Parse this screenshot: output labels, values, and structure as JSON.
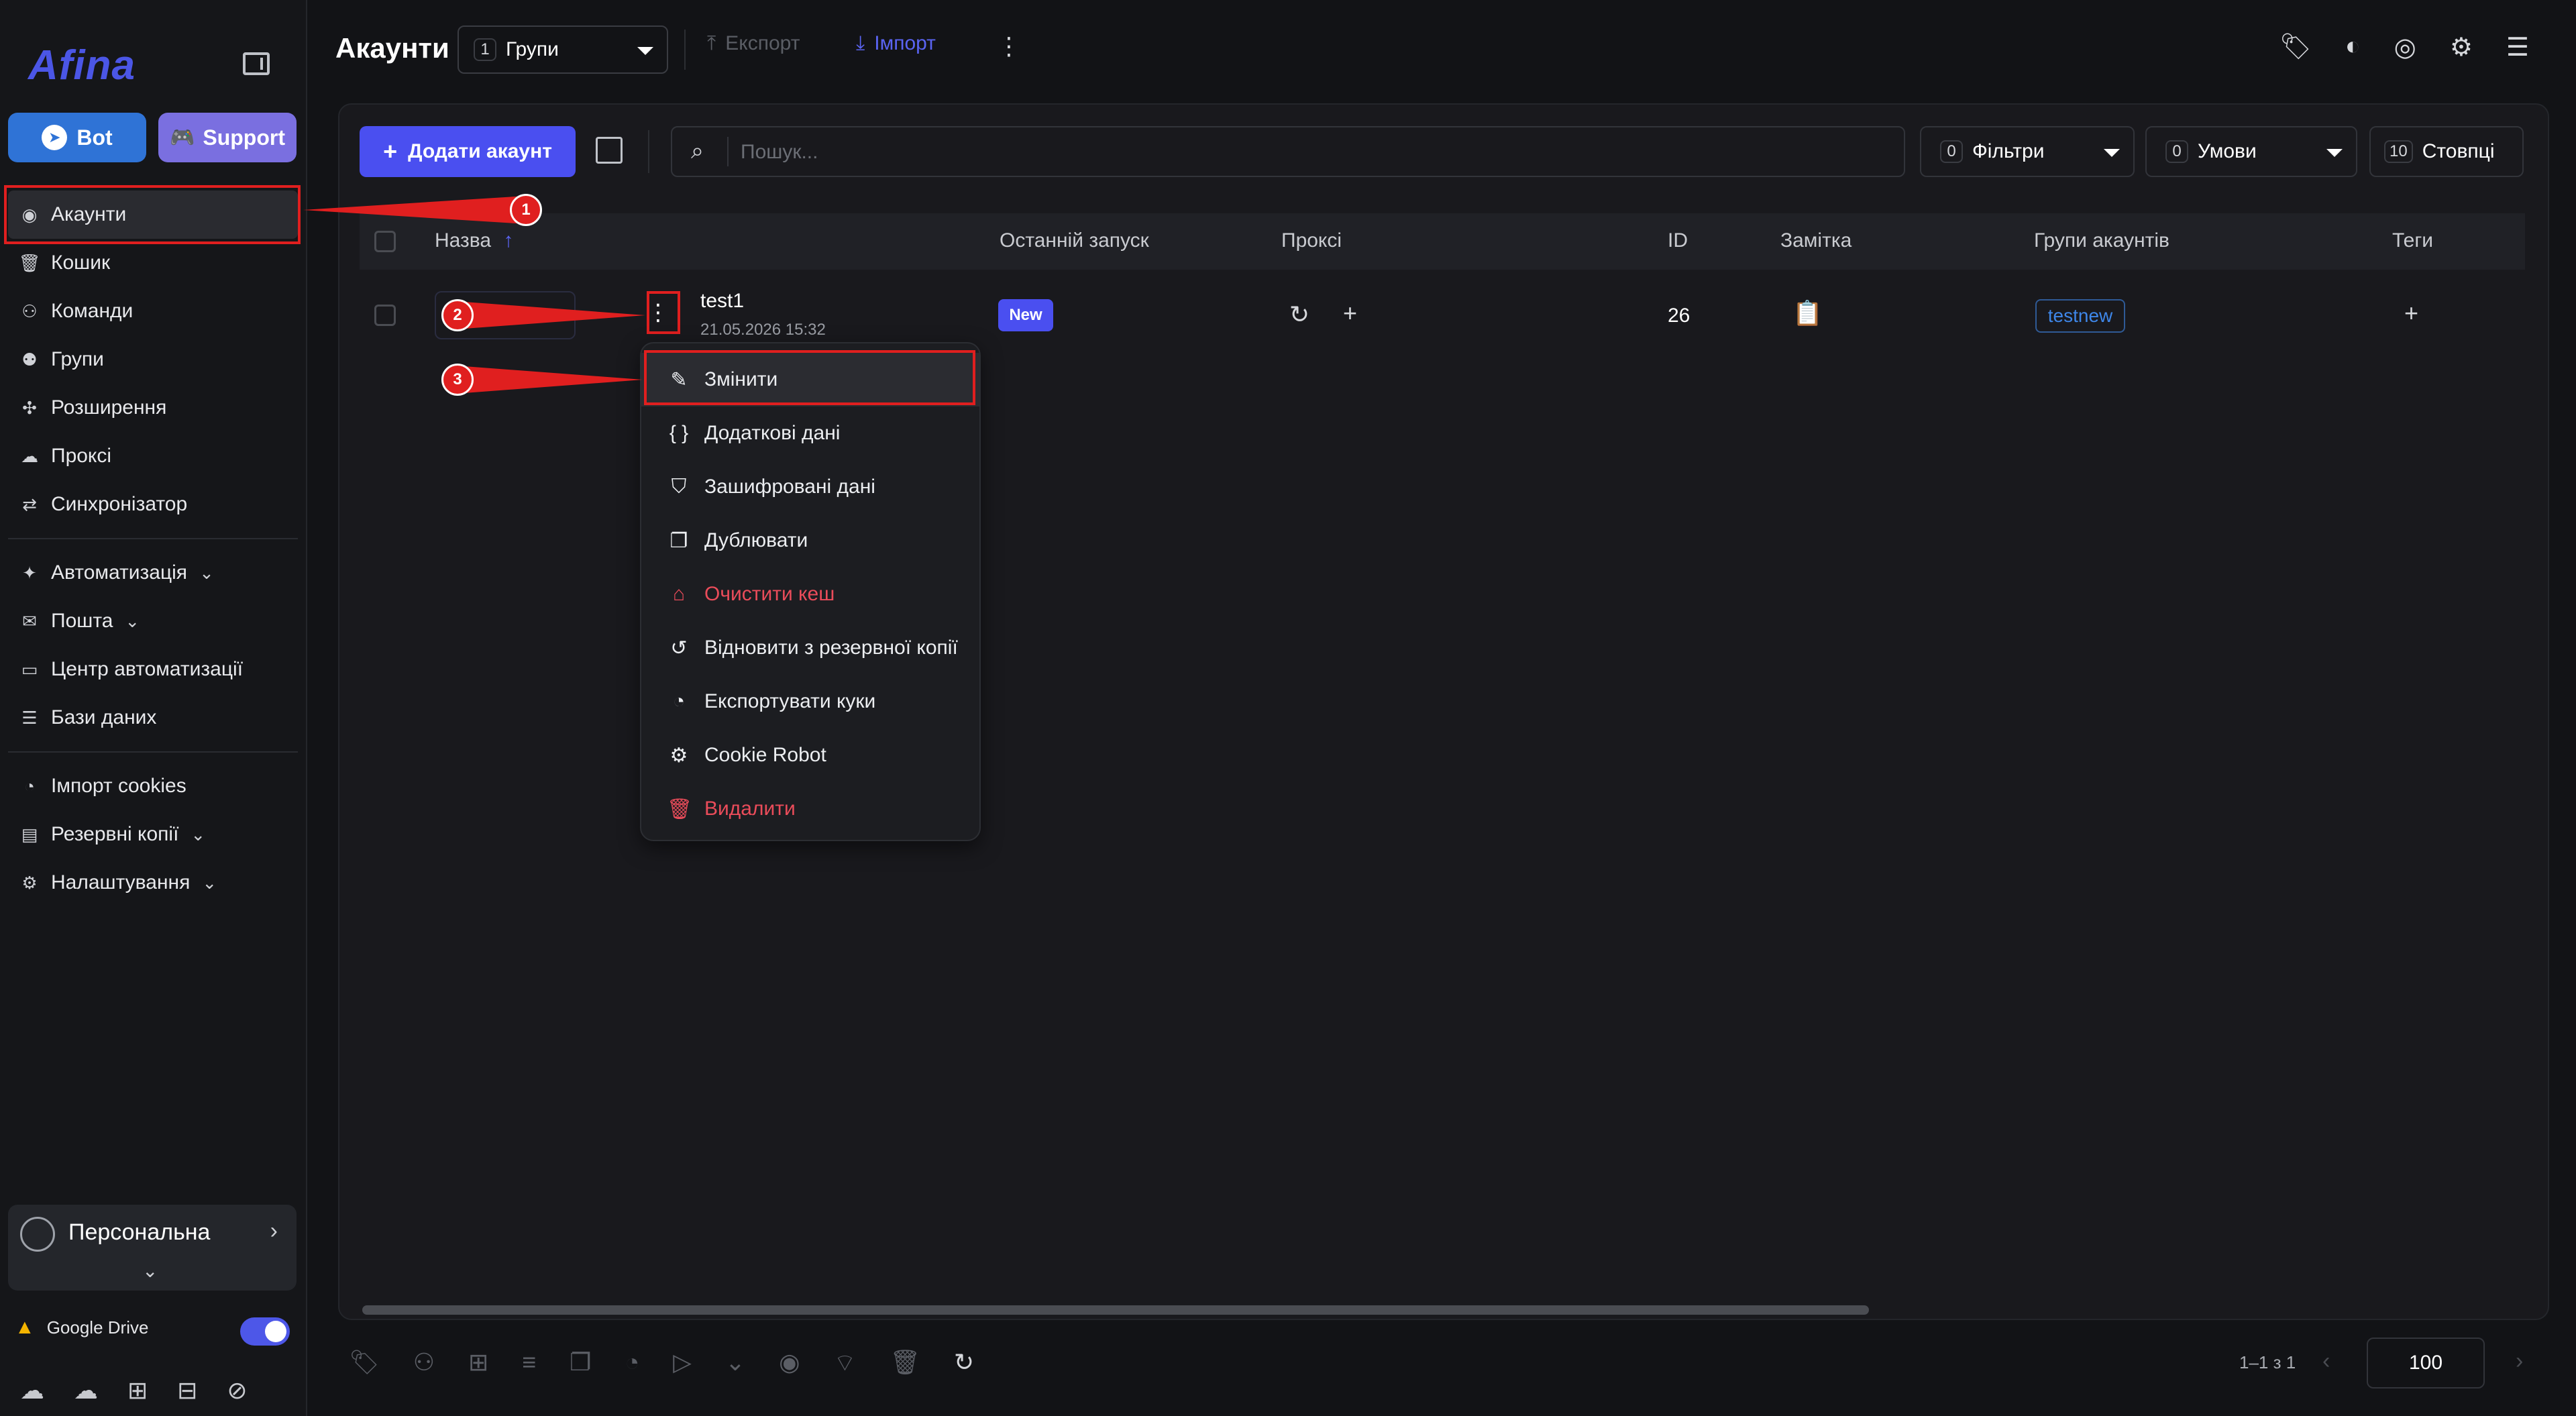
{
  "sidebar": {
    "logo": "Afina",
    "bot_label": "Bot",
    "support_label": "Support",
    "nav1": [
      {
        "label": "Акаунти",
        "icon": "user-circle-icon"
      },
      {
        "label": "Кошик",
        "icon": "trash-icon"
      },
      {
        "label": "Команди",
        "icon": "team-icon"
      },
      {
        "label": "Групи",
        "icon": "groups-icon"
      },
      {
        "label": "Розширення",
        "icon": "puzzle-icon"
      },
      {
        "label": "Проксі",
        "icon": "cloud-icon"
      },
      {
        "label": "Синхронізатор",
        "icon": "sync-icon"
      }
    ],
    "nav2": [
      {
        "label": "Автоматизація",
        "icon": "automation-icon"
      },
      {
        "label": "Пошта",
        "icon": "mail-icon"
      },
      {
        "label": "Центр автоматизації",
        "icon": "laptop-icon"
      },
      {
        "label": "Бази даних",
        "icon": "database-icon"
      }
    ],
    "nav3": [
      {
        "label": "Імпорт cookies",
        "icon": "cookie-icon"
      },
      {
        "label": "Резервні копії",
        "icon": "backup-icon"
      },
      {
        "label": "Налаштування",
        "icon": "gear-icon"
      }
    ],
    "workspace": "Персональна",
    "gdrive_label": "Google Drive",
    "gdrive_enabled": true
  },
  "header": {
    "title": "Акаунти",
    "groups_count": "1",
    "groups_label": "Групи",
    "export_label": "Експорт",
    "import_label": "Імпорт"
  },
  "toolbar": {
    "add_label": "Додати акаунт",
    "search_placeholder": "Пошук...",
    "filters_count": "0",
    "filters_label": "Фільтри",
    "conditions_count": "0",
    "conditions_label": "Умови",
    "columns_count": "10",
    "columns_label": "Стовпці"
  },
  "table": {
    "headers": [
      "Назва",
      "Останній запуск",
      "Проксі",
      "ID",
      "Замітка",
      "Групи акаунтів",
      "Теги"
    ],
    "row": {
      "name": "test1",
      "date": "21.05.2026 15:32",
      "last_run": "New",
      "id": "26",
      "group": "testnew"
    }
  },
  "menu": [
    {
      "label": "Змінити",
      "icon": "pencil-icon",
      "danger": false
    },
    {
      "label": "Додаткові дані",
      "icon": "braces-icon",
      "danger": false
    },
    {
      "label": "Зашифровані дані",
      "icon": "shield-icon",
      "danger": false
    },
    {
      "label": "Дублювати",
      "icon": "copy-icon",
      "danger": false
    },
    {
      "label": "Очистити кеш",
      "icon": "broom-icon",
      "danger": true
    },
    {
      "label": "Відновити з резервної копії",
      "icon": "history-icon",
      "danger": false
    },
    {
      "label": "Експортувати куки",
      "icon": "cookie-icon",
      "danger": false
    },
    {
      "label": "Cookie Robot",
      "icon": "robot-icon",
      "danger": false
    },
    {
      "label": "Видалити",
      "icon": "trash-icon",
      "danger": true
    }
  ],
  "footer": {
    "page_info": "1–1 з 1",
    "per_page": "100"
  },
  "annotations": [
    "1",
    "2",
    "3"
  ],
  "colors": {
    "accent": "#4a4ff0",
    "danger": "#ea4c5a",
    "annotation": "#e01f1f"
  }
}
